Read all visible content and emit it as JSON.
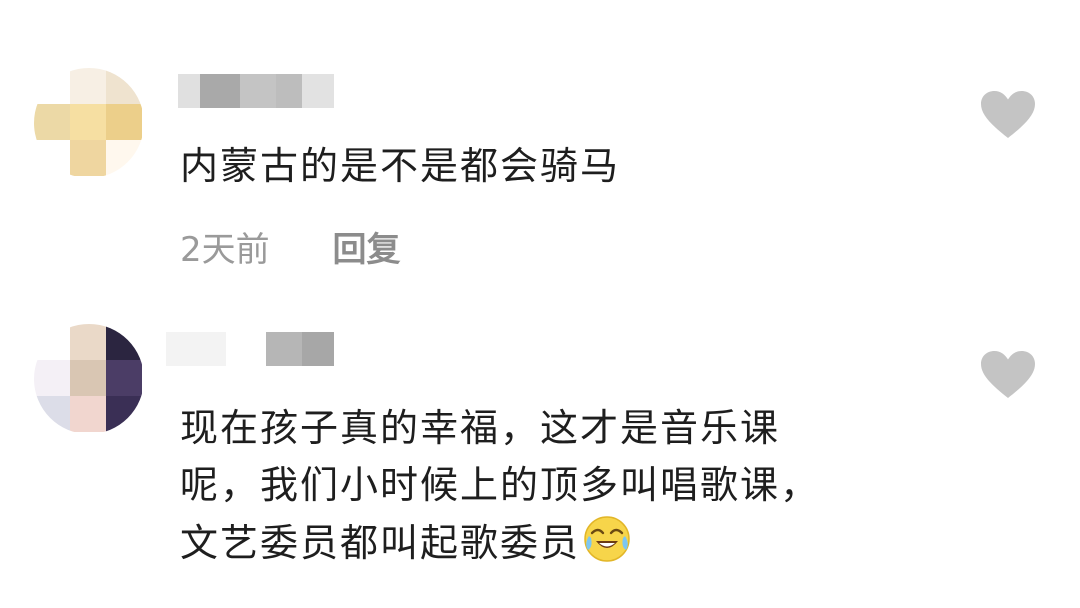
{
  "comments": [
    {
      "text_lines": [
        "内蒙古的是不是都会骑马"
      ],
      "time": "2天前",
      "reply_label": "回复",
      "like_icon": "heart-icon"
    },
    {
      "text_lines": [
        "现在孩子真的幸福，这才是音乐课",
        "呢，我们小时候上的顶多叫唱歌课，",
        "文艺委员都叫起歌委员"
      ],
      "emoji_icon": "laugh-cry-emoji-icon",
      "like_icon": "heart-icon"
    }
  ],
  "colors": {
    "heart": "#c4c4c4",
    "meta_text": "#9a9a9a",
    "body_text": "#1e1e1e"
  }
}
